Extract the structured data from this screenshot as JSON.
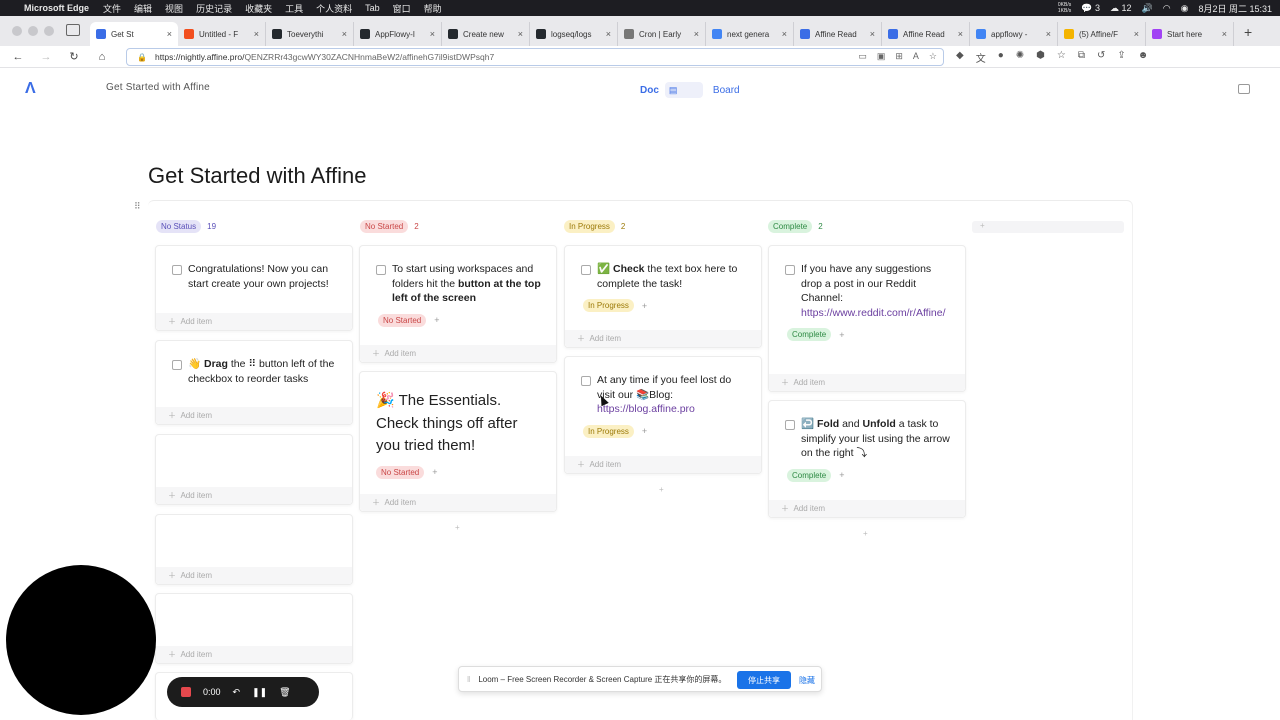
{
  "menubar": {
    "app_name": "Microsoft Edge",
    "menus": [
      "文件",
      "编辑",
      "视图",
      "历史记录",
      "收藏夹",
      "工具",
      "个人资料",
      "Tab",
      "窗口",
      "帮助"
    ],
    "net_up": "0KB/s",
    "net_down": "1KB/s",
    "wechat_count": "3",
    "notif_count": "12",
    "datetime": "8月2日 周二  15:31"
  },
  "tabs": [
    {
      "title": "Get St",
      "color": "#3b6de6",
      "active": true
    },
    {
      "title": "Untitled - F",
      "color": "#f24e1e"
    },
    {
      "title": "Toeverythi",
      "color": "#24292e"
    },
    {
      "title": "AppFlowy-I",
      "color": "#24292e"
    },
    {
      "title": "Create new",
      "color": "#24292e"
    },
    {
      "title": "logseq/logs",
      "color": "#24292e"
    },
    {
      "title": "Cron | Early",
      "color": "#777777"
    },
    {
      "title": "next genera",
      "color": "#4285f4"
    },
    {
      "title": "Affine Read",
      "color": "#3b6de6"
    },
    {
      "title": "Affine Read",
      "color": "#3b6de6"
    },
    {
      "title": "appflowy -",
      "color": "#4285f4"
    },
    {
      "title": "(5) Affine/F",
      "color": "#f4b400"
    },
    {
      "title": "Start here",
      "color": "#a142f4"
    }
  ],
  "address": {
    "url_host": "https://nightly.affine.pro/",
    "url_path": "QENZRRr43gcwWY30ZACNHnmaBeW2/affinehG7il9istDWPsqh7"
  },
  "header": {
    "workspace_title": "Get Started with Affine",
    "doc_label": "Doc",
    "board_label": "Board"
  },
  "page": {
    "title": "Get Started with Affine"
  },
  "columns": [
    {
      "label": "No Status",
      "count": "19"
    },
    {
      "label": "No Started",
      "count": "2"
    },
    {
      "label": "In Progress",
      "count": "2"
    },
    {
      "label": "Complete",
      "count": "2"
    }
  ],
  "add_item": "Add item",
  "cards": {
    "c1": "Congratulations! Now you can start create your own projects!",
    "c2_a": "👋 ",
    "c2_b": "Drag",
    "c2_c": " the ⠿ button left of the checkbox to reorder tasks",
    "c3_a": "To start using workspaces and folders hit the ",
    "c3_b": "button at the top left of the screen",
    "c3_tag": "No Started",
    "c4": "🎉 The Essentials. Check things off after you tried them!",
    "c4_tag": "No Started",
    "c5_a": "✅ ",
    "c5_b": "Check",
    "c5_c": " the text box here to complete the task!",
    "c5_tag": "In Progress",
    "c6_a": "At any time if you feel lost do visit our 📚Blog:",
    "c6_link": "https://blog.affine.pro",
    "c6_tag": "In Progress",
    "c7_a": "If you have any suggestions drop a post in our Reddit Channel:",
    "c7_link": "https://www.reddit.com/r/Affine/",
    "c7_tag": "Complete",
    "c8_a": "↩️ ",
    "c8_b": "Fold",
    "c8_c": " and ",
    "c8_d": "Unfold",
    "c8_e": " a task to simplify your list using the arrow on the right ⤵",
    "c8_tag": "Complete"
  },
  "loom": {
    "timer": "0:00",
    "share_text": "Loom – Free Screen Recorder & Screen Capture 正在共享你的屏幕。",
    "stop_label": "停止共享",
    "hide_label": "隐藏"
  }
}
